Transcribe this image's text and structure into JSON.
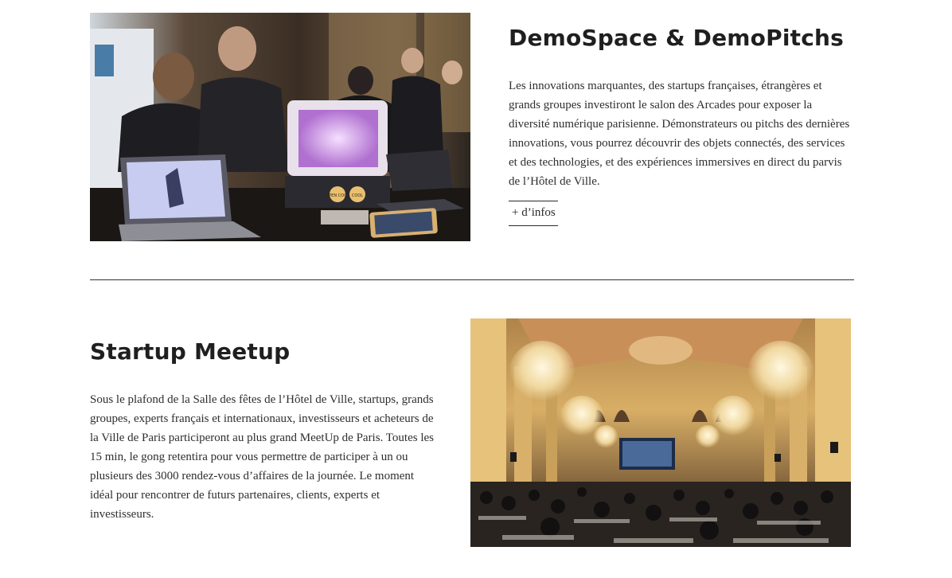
{
  "sections": [
    {
      "title": "DemoSpace & DemoPitchs",
      "text": "Les innovations marquantes, des startups françaises, étrangères et grands groupes investiront le salon des Arcades pour exposer la diversité numérique parisienne. Démonstrateurs ou pitchs des dernières innovations, vous pourrez découvrir des objets connectés, des services et des technologies, et des expériences immersives en direct du parvis de l’Hôtel de Ville.",
      "link_label": "+ d’infos",
      "photo_stickers": [
        "OPEN COOL",
        "COOL"
      ]
    },
    {
      "title": "Startup Meetup",
      "text": "Sous le plafond de la Salle des fêtes de l’Hôtel de Ville, startups, grands groupes, experts français et internationaux, investisseurs et acheteurs de la Ville de Paris participeront au plus grand MeetUp de Paris. Toutes les 15 min, le gong retentira pour vous permettre de participer à un ou plusieurs des 3000 rendez-vous d’affaires de la journée. Le moment idéal pour rencontrer de futurs partenaires, clients, experts et investisseurs."
    }
  ],
  "colors": {
    "text": "#2e2e2e",
    "heading": "#1f1f1f",
    "divider": "#333333",
    "gold": "#c9a05a"
  }
}
